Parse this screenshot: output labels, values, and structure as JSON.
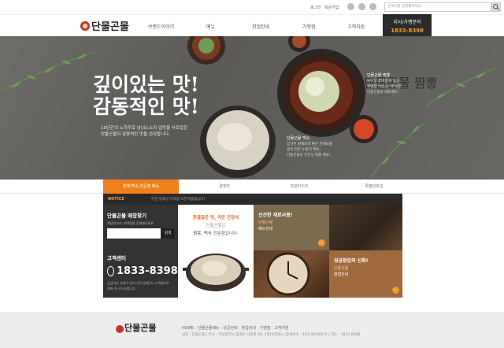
{
  "topbar": {
    "login": "로그인",
    "join": "회원가입",
    "search_placeholder": "검색어를 입력해주세요"
  },
  "logo": {
    "text": "단물곤물"
  },
  "gnb": {
    "menu": [
      "브랜드이야기",
      "메뉴",
      "창업안내",
      "가맹점",
      "고객지원"
    ],
    "franchise_title": "지사/가맹문의",
    "franchise_phone": "1833-8398"
  },
  "hero": {
    "title1": "깊이있는 맛!",
    "title2": "감동적인 맛!",
    "desc1": "10년간의 노하우로 남녀노소의 입맛을 사로잡은",
    "desc2": "단물곤물이 감동적인 맛을 선사합니다.",
    "dish1_name": "단물곤물 짬뽕",
    "dish1_desc": [
      "누구도 흉내낼 수 없는",
      "특별한 비법소스로 만든",
      "단물곤물의 대표메뉴!"
    ],
    "dish2_name": "단물곤물 백숙",
    "dish2_desc": [
      "엄선된 원재료와 좋은 한재료를",
      "넣어 만든 누룽지 백숙,",
      "단물곤물의 건강식 명품 메뉴!"
    ]
  },
  "tabs": [
    "짬뽕/백숙 전문점 메뉴",
    "경쟁력",
    "프랜차이즈",
    "특별한창업"
  ],
  "notice": {
    "label": "NOTICE",
    "text": "부산 동래구 사직점 오픈하였습니다!"
  },
  "store_finder": {
    "title": "단물곤물 매장찾기",
    "hint": "해당명 또는 지역명을 입력해주세요",
    "button": "검색"
  },
  "customer_center": {
    "title": "고객센터",
    "phone": "1833-8398",
    "note1": "궁금하신 사항이 있으시면 언제든지 고객센터로",
    "note2": "전화 주시기 바랍니다."
  },
  "promo": {
    "line1": "한결같은 맛, 국민 건강식",
    "line2": "단물곤물은",
    "line3": "짬뽕, 백숙 전문점입니다."
  },
  "tiles": {
    "fresh_title": "신선한 재료사용!",
    "fresh_sub": "단물곤물",
    "fresh_menu": "메뉴안내",
    "open_title": "성공창업의 신화!",
    "open_sub": "단물곤물",
    "open_guide": "창업안내",
    "arrow": "›"
  },
  "footer": {
    "logo": "단물곤물",
    "nav": "HOME · 단물곤물메뉴 · 성공전략 · 창업안내 · 가맹점 · 고객지원",
    "info": "상호 : 단물곤물 | 주소 : 부산광역시 동래구 사직로 60, 1층(사직동) | 등록번호 : 143-38-00071 | TEL : 1833-8398"
  },
  "colors": {
    "accent": "#f0801c",
    "dark": "#2b2b2b"
  }
}
